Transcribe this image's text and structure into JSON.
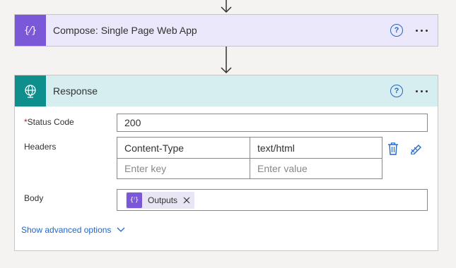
{
  "compose": {
    "title": "Compose: Single Page Web App",
    "help_icon": "question-circle-icon",
    "more_icon": "ellipsis-icon",
    "color": "#7a58d8",
    "icon_glyph": "{⁄}"
  },
  "response": {
    "title": "Response",
    "color": "#0f8e8e",
    "status_code": {
      "label": "Status Code",
      "required_mark": "*",
      "value": "200"
    },
    "headers": {
      "label": "Headers",
      "rows": [
        {
          "key": "Content-Type",
          "value": "text/html"
        }
      ],
      "key_placeholder": "Enter key",
      "value_placeholder": "Enter value"
    },
    "body": {
      "label": "Body",
      "token": {
        "label": "Outputs",
        "icon_glyph": "{ⁱ}"
      }
    },
    "advanced_link": "Show advanced options"
  }
}
